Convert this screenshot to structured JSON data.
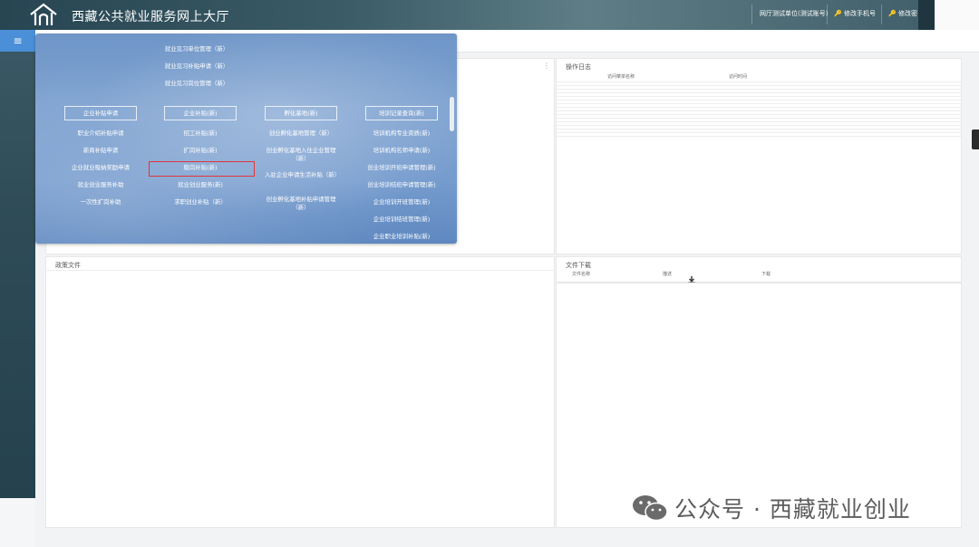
{
  "header": {
    "site_title": "西藏公共就业服务网上大厅",
    "user_label": "网厅测试单位(测试账号)",
    "change_phone": "修改手机号",
    "change_password": "修改密码"
  },
  "rail": {
    "menu_toggle": "≡"
  },
  "panels": {
    "operation_log": {
      "title": "操作日志",
      "col_menu": "访问菜单名称",
      "col_time": "访问时间"
    },
    "policy_files": {
      "title": "政策文件"
    },
    "file_download": {
      "title": "文件下载",
      "col_name": "文件名称",
      "col_desc": "描述",
      "col_download": "下载"
    }
  },
  "menu": {
    "top_items": [
      "就业见习单位管理（新）",
      "就业见习补贴申请（新）",
      "就业见习岗位管理（新）"
    ],
    "columns": [
      {
        "header": "企业补贴申请",
        "items": [
          "职业介绍补贴申请",
          "新商补贴申请",
          "企业就业吸纳奖励申请",
          "就业创业服务补助",
          "一次性扩岗补助"
        ]
      },
      {
        "header": "企业补贴(新)",
        "items": [
          "招工补贴(新)",
          "扩岗补贴(新)",
          "稳岗补贴(新)",
          "就业创业服务(新)",
          "求职创业补贴（新）"
        ]
      },
      {
        "header": "孵化基地(新)",
        "items": [
          "创业孵化基地管理（新）",
          "创业孵化基地入住企业管理（新）",
          "入驻企业申请生活补贴（新）",
          "创业孵化基地补贴申请管理（新）"
        ]
      },
      {
        "header": "培训记录查询(新)",
        "items": [
          "培训机构专业资质(新)",
          "培训机构名师申请(新)",
          "创业培训开班申请管理(新)",
          "创业培训结班申请管理(新)",
          "企业培训开班管理(新)",
          "企业培训结班管理(新)",
          "企业职业培训补贴(新)"
        ]
      }
    ],
    "highlighted": "稳岗补贴(新)"
  },
  "watermark": {
    "text": "公众号 · 西藏就业创业"
  }
}
